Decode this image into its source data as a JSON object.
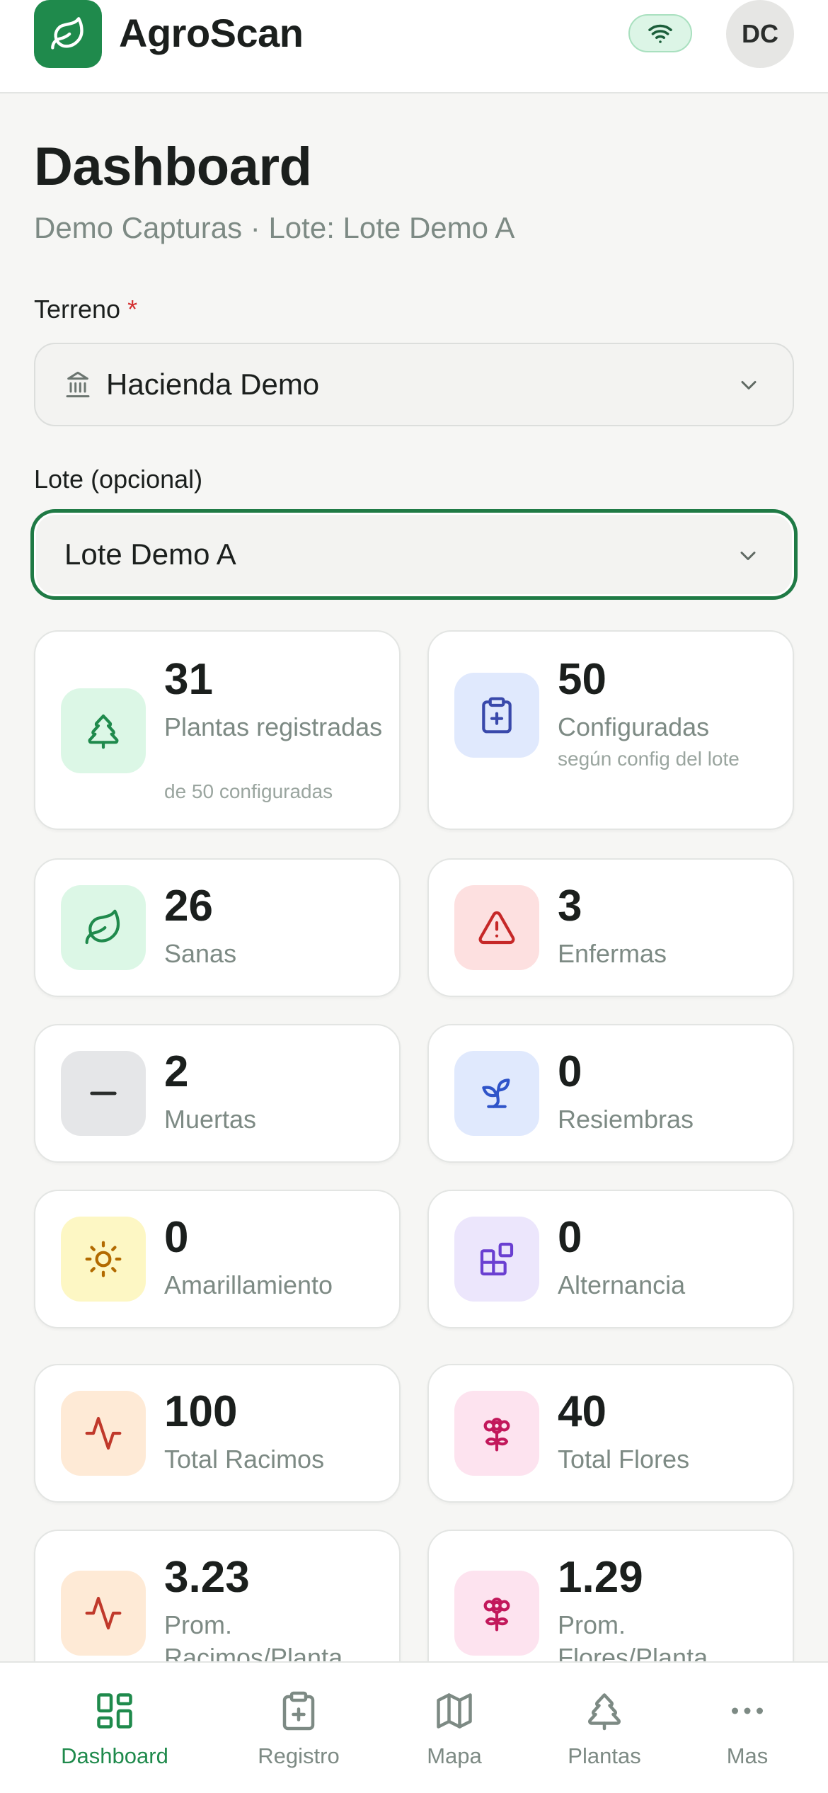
{
  "header": {
    "app_title": "AgroScan",
    "avatar_initials": "DC",
    "brand_color": "#1f8a4c",
    "icons": {
      "logo": "leaf-icon",
      "connection": "wifi-icon"
    }
  },
  "page": {
    "title": "Dashboard",
    "subtitle": "Demo Capturas · Lote: Lote Demo A"
  },
  "filters": {
    "terreno_label": "Terreno",
    "terreno_required_mark": "*",
    "terreno_value": "Hacienda Demo",
    "lote_label": "Lote (opcional)",
    "lote_value": "Lote Demo A"
  },
  "stats": [
    {
      "value": "31",
      "label": "Plantas registradas",
      "sub": "de 50 configuradas",
      "icon": "tree-icon",
      "bg": "#dcf7e6",
      "color": "#1f8a4c"
    },
    {
      "value": "50",
      "label": "Configuradas",
      "sub": "según config del lote",
      "icon": "clipboard-plus-icon",
      "bg": "#e0e9fd",
      "color": "#3949ab"
    },
    {
      "value": "26",
      "label": "Sanas",
      "icon": "leaf-icon",
      "bg": "#dcf7e6",
      "color": "#1f8a4c"
    },
    {
      "value": "3",
      "label": "Enfermas",
      "icon": "warning-icon",
      "bg": "#fde0e0",
      "color": "#c62828"
    },
    {
      "value": "2",
      "label": "Muertas",
      "icon": "minus-icon",
      "bg": "#e5e6e8",
      "color": "#2a2d2b"
    },
    {
      "value": "0",
      "label": "Resiembras",
      "icon": "sprout-icon",
      "bg": "#e0e9fd",
      "color": "#2f54c9"
    },
    {
      "value": "0",
      "label": "Amarillamiento",
      "icon": "sun-icon",
      "bg": "#fdf7c4",
      "color": "#b26a00"
    },
    {
      "value": "0",
      "label": "Alternancia",
      "icon": "blocks-icon",
      "bg": "#ece6fc",
      "color": "#6a3fd1"
    },
    {
      "value": "100",
      "label": "Total Racimos",
      "icon": "activity-icon",
      "bg": "#feead6",
      "color": "#c0392b"
    },
    {
      "value": "40",
      "label": "Total Flores",
      "icon": "flower-icon",
      "bg": "#fde3ef",
      "color": "#c2185b"
    },
    {
      "value": "3.23",
      "label": "Prom. Racimos/Planta",
      "icon": "activity-icon",
      "bg": "#feead6",
      "color": "#c0392b"
    },
    {
      "value": "1.29",
      "label": "Prom. Flores/Planta",
      "icon": "flower-icon",
      "bg": "#fde3ef",
      "color": "#c2185b"
    }
  ],
  "bottom_nav": [
    {
      "label": "Dashboard",
      "icon": "grid-icon",
      "active": true
    },
    {
      "label": "Registro",
      "icon": "clipboard-plus-icon"
    },
    {
      "label": "Mapa",
      "icon": "map-icon"
    },
    {
      "label": "Plantas",
      "icon": "tree-icon"
    },
    {
      "label": "Mas",
      "icon": "more-icon"
    }
  ],
  "colors": {
    "nav_active": "#1f8a4c",
    "nav_inactive": "#7d8a84",
    "focus_ring": "#1f7a45"
  }
}
